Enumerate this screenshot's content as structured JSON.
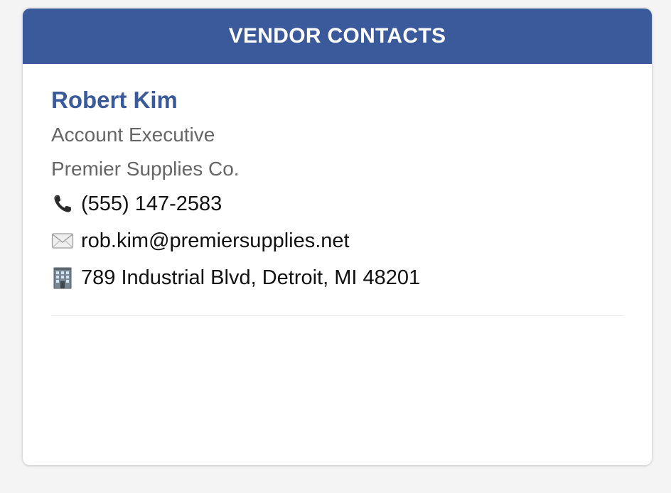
{
  "header": {
    "title": "VENDOR CONTACTS"
  },
  "contact": {
    "name": "Robert Kim",
    "title": "Account Executive",
    "company": "Premier Supplies Co.",
    "phone": "(555) 147-2583",
    "email": "rob.kim@premiersupplies.net",
    "address": "789 Industrial Blvd, Detroit, MI 48201",
    "phone_icon": "phone-icon",
    "email_icon": "envelope-icon",
    "address_icon": "building-icon"
  },
  "colors": {
    "accent": "#3a5a9c",
    "muted_text": "#666666",
    "background": "#f4f4f4"
  }
}
